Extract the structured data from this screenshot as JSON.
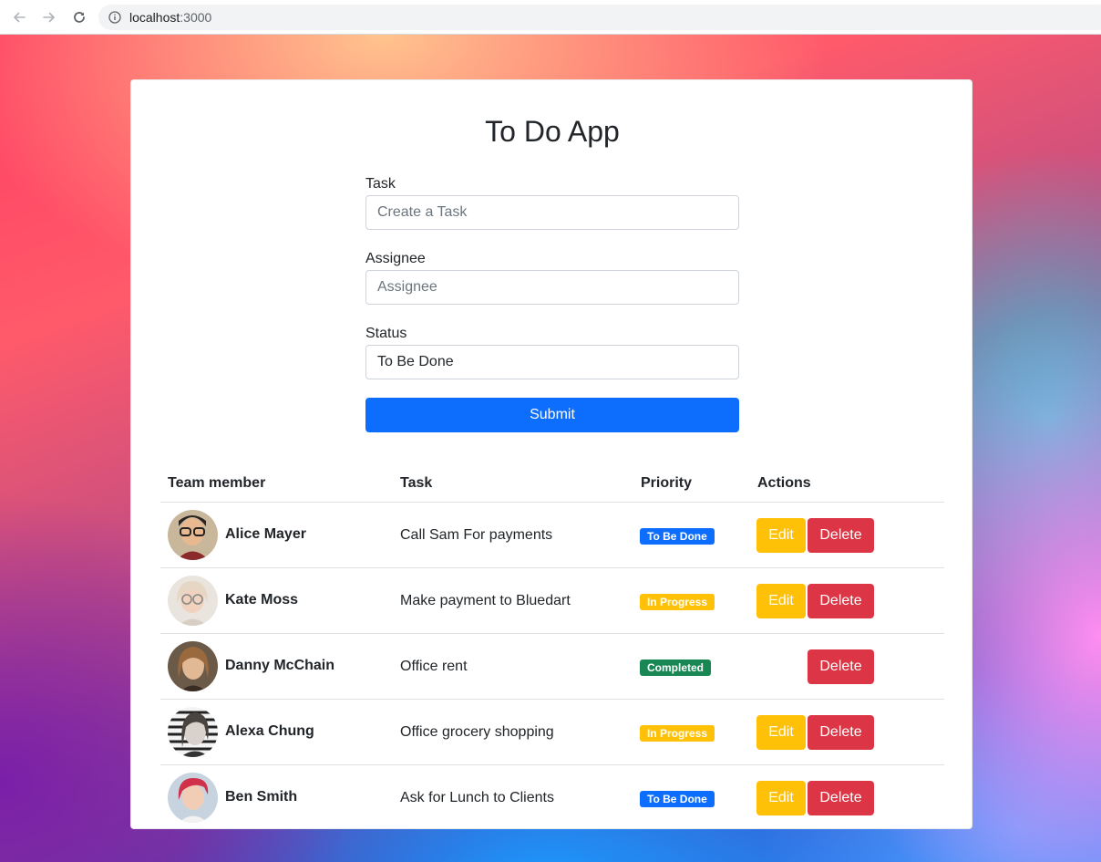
{
  "browser": {
    "url_host": "localhost",
    "url_port": ":3000"
  },
  "app": {
    "title": "To Do App"
  },
  "form": {
    "task_label": "Task",
    "task_placeholder": "Create a Task",
    "assignee_label": "Assignee",
    "assignee_placeholder": "Assignee",
    "status_label": "Status",
    "status_value": "To Be Done",
    "submit_label": "Submit"
  },
  "table": {
    "headers": [
      "Team member",
      "Task",
      "Priority",
      "Actions"
    ],
    "rows": [
      {
        "name": "Alice Mayer",
        "task": "Call Sam For payments",
        "priority": "To Be Done",
        "priority_style": "blue",
        "has_edit": true
      },
      {
        "name": "Kate Moss",
        "task": "Make payment to Bluedart",
        "priority": "In Progress",
        "priority_style": "yellow",
        "has_edit": true
      },
      {
        "name": "Danny McChain",
        "task": "Office rent",
        "priority": "Completed",
        "priority_style": "green",
        "has_edit": false
      },
      {
        "name": "Alexa Chung",
        "task": "Office grocery shopping",
        "priority": "In Progress",
        "priority_style": "yellow",
        "has_edit": true
      },
      {
        "name": "Ben Smith",
        "task": "Ask for Lunch to Clients",
        "priority": "To Be Done",
        "priority_style": "blue",
        "has_edit": true
      }
    ],
    "edit_label": "Edit",
    "delete_label": "Delete"
  },
  "colors": {
    "primary": "#0d6efd",
    "warning": "#ffc107",
    "success": "#198754",
    "danger": "#dc3545"
  }
}
